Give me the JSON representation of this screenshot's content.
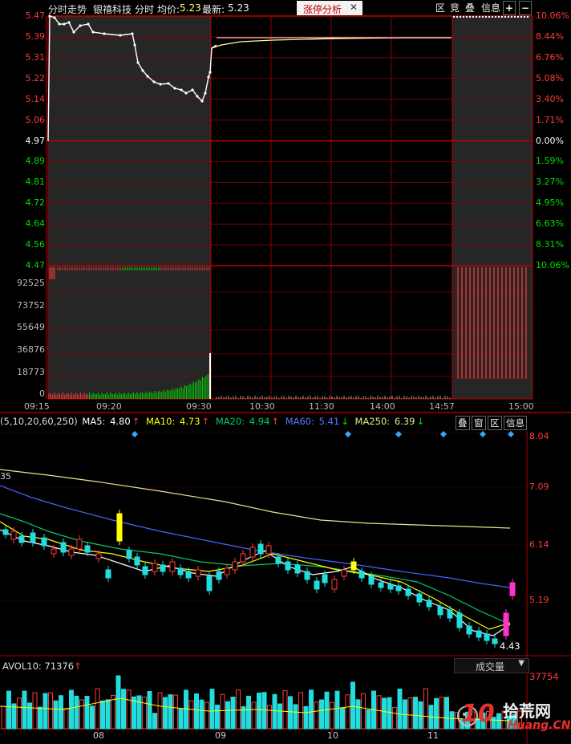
{
  "header": {
    "mode": "分时走势",
    "stock_name": "银禧科技",
    "period": "分时",
    "avg_label": "均价:",
    "avg_value": "5.23",
    "last_label": "最新:",
    "last_value": "5.23",
    "tag_label": "涨停分析",
    "tag_close": "✕",
    "tools": [
      "区",
      "竞",
      "叠",
      "信息"
    ],
    "plus": "+",
    "minus": "−"
  },
  "intraday": {
    "price_ticks": [
      "5.47",
      "5.39",
      "5.31",
      "5.22",
      "5.14",
      "5.06",
      "4.97",
      "4.89",
      "4.81",
      "4.72",
      "4.64",
      "4.56",
      "4.47"
    ],
    "pct_ticks": [
      "10.06%",
      "8.44%",
      "6.76%",
      "5.08%",
      "3.40%",
      "1.71%",
      "0.00%",
      "1.59%",
      "3.27%",
      "4.95%",
      "6.63%",
      "8.31%",
      "10.06%"
    ],
    "volume_ticks": [
      "92525",
      "73752",
      "55649",
      "36876",
      "18773",
      "0"
    ],
    "time_ticks": [
      "09:15",
      "09:20",
      "09:30",
      "10:30",
      "11:30",
      "14:00",
      "14:57",
      "15:00"
    ],
    "colors": {
      "up": "#ff3a3a",
      "down": "#00dd00",
      "price": "#ffffff",
      "avg": "#ffff99",
      "grid": "#8b0000"
    }
  },
  "kline_legend": {
    "params": "(5,10,20,60,250)",
    "ma5_label": "MA5:",
    "ma5_value": "4.80",
    "ma5_arrow": "↑",
    "ma10_label": "MA10:",
    "ma10_value": "4.73",
    "ma10_arrow": "↑",
    "ma20_label": "MA20:",
    "ma20_value": "4.94",
    "ma20_arrow": "↑",
    "ma60_label": "MA60:",
    "ma60_value": "5.41",
    "ma60_arrow": "↓",
    "ma250_label": "MA250:",
    "ma250_value": "6.39",
    "ma250_arrow": "↓",
    "tools": [
      "叠",
      "窗",
      "区",
      "信息"
    ],
    "colors": {
      "ma5": "#ffffff",
      "ma10": "#ffff00",
      "ma20": "#00cc66",
      "ma60": "#4466ff",
      "ma250": "#e6e68c"
    }
  },
  "kline": {
    "price_ticks": [
      "8.04",
      "7.09",
      "6.14",
      "5.19"
    ],
    "left_cut_label": "35",
    "low_label": "4.43",
    "month_ticks": [
      "08",
      "09",
      "10",
      "11"
    ]
  },
  "volume": {
    "vol10_label": "AVOL10:",
    "vol10_value": "71376",
    "vol10_arrow": "↑",
    "top_tick": "37754",
    "dropdown_label": "成交量",
    "dropdown_arrow": "▼"
  },
  "watermark": {
    "big": "10",
    "cn": "拾荒网",
    "url": "Huang.CN"
  }
}
